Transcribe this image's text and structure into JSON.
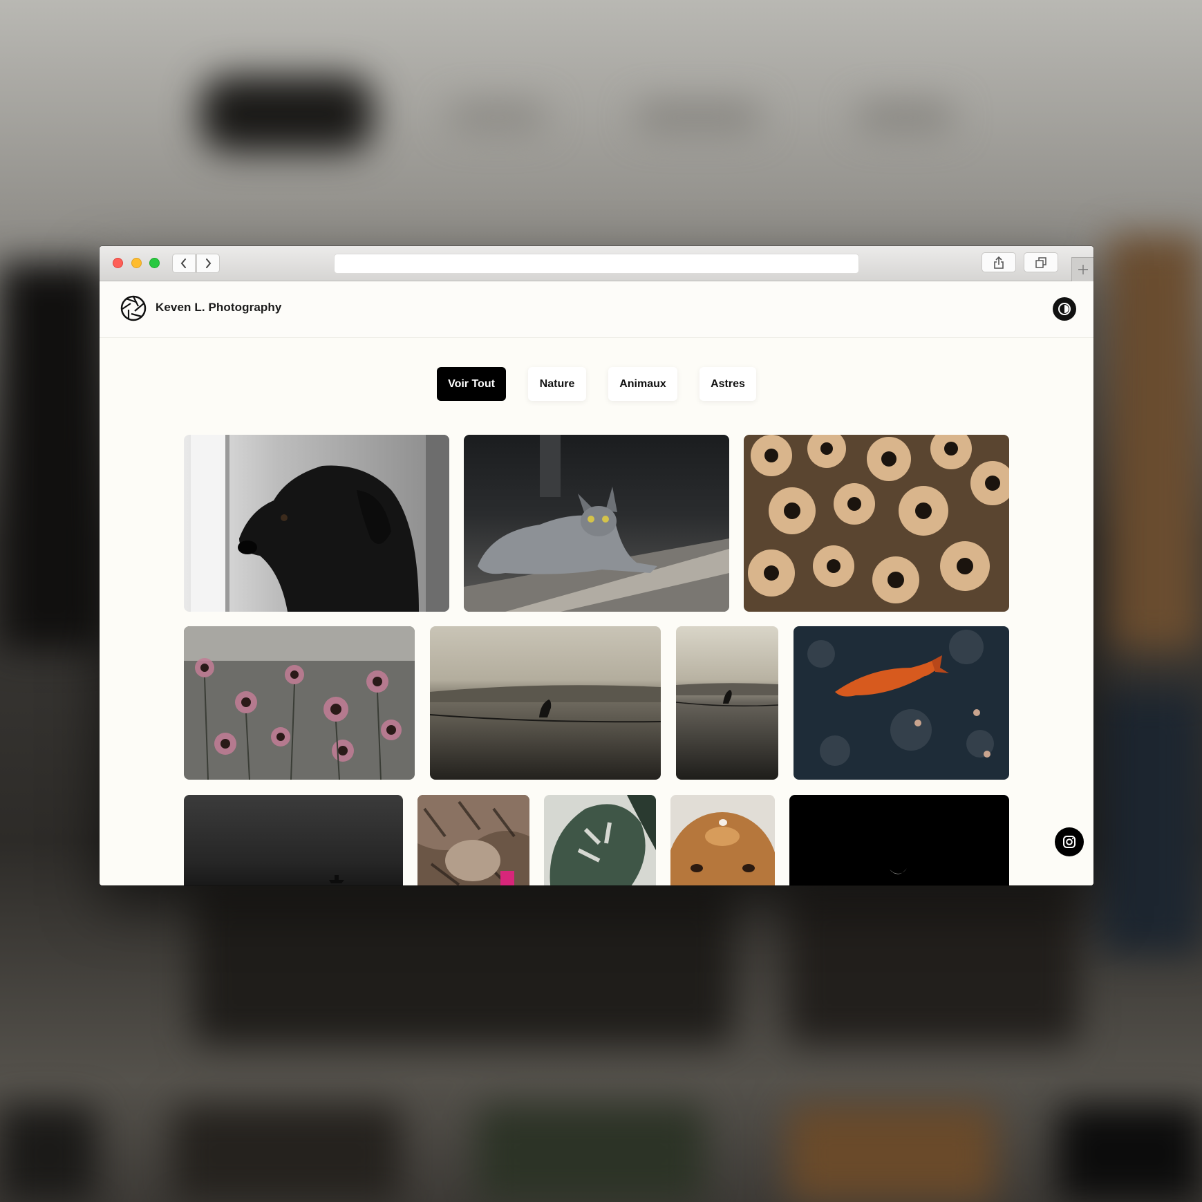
{
  "site": {
    "title": "Keven L. Photography"
  },
  "filters": [
    {
      "label": "Voir Tout",
      "active": true
    },
    {
      "label": "Nature",
      "active": false
    },
    {
      "label": "Animaux",
      "active": false
    },
    {
      "label": "Astres",
      "active": false
    }
  ],
  "icons": {
    "logo": "camera-aperture-icon",
    "theme_toggle": "contrast-icon",
    "social": "instagram-icon"
  },
  "gallery": [
    {
      "subject": "black dog portrait"
    },
    {
      "subject": "sphynx cat on wooden floor"
    },
    {
      "subject": "black-eyed susan flowers"
    },
    {
      "subject": "coneflowers"
    },
    {
      "subject": "bird on wire landscape"
    },
    {
      "subject": "bird on wire portrait"
    },
    {
      "subject": "koi fish in pond"
    },
    {
      "subject": "boat on dark sea"
    },
    {
      "subject": "tabby kittens"
    },
    {
      "subject": "monstera leaf"
    },
    {
      "subject": "dog close-up"
    },
    {
      "subject": "crescent moon"
    }
  ],
  "colors": {
    "accent": "#000000",
    "page_background": "#fdfcf7",
    "traffic_red": "#fe5f57",
    "traffic_yellow": "#febc2e",
    "traffic_green": "#28c840"
  }
}
